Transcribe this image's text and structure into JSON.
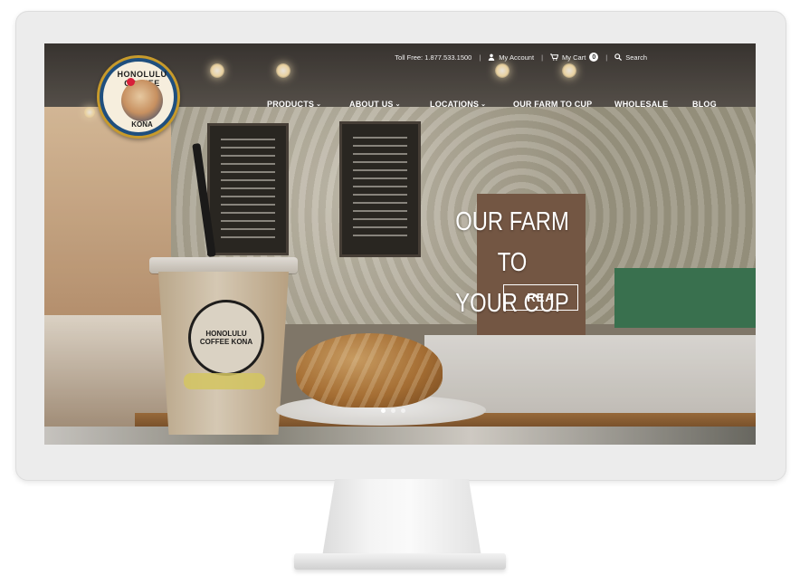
{
  "topbar": {
    "toll_free": "Toll Free: 1.877.533.1500",
    "account": "My Account",
    "cart": "My Cart",
    "cart_count": "0",
    "search": "Search"
  },
  "logo": {
    "top_text": "HONOLULU COFFEE",
    "bottom_text": "KONA"
  },
  "nav": {
    "items": [
      {
        "label": "PRODUCTS"
      },
      {
        "label": "ABOUT US"
      },
      {
        "label": "LOCATIONS"
      },
      {
        "label": "OUR FARM TO CUP"
      },
      {
        "label": "WHOLESALE"
      },
      {
        "label": "BLOG"
      }
    ],
    "dropdown_caret": "⌄"
  },
  "hero": {
    "line1": "OUR FARM TO",
    "line2": "YOUR CUP",
    "button": "REA"
  },
  "cup_logo": "HONOLULU COFFEE KONA"
}
